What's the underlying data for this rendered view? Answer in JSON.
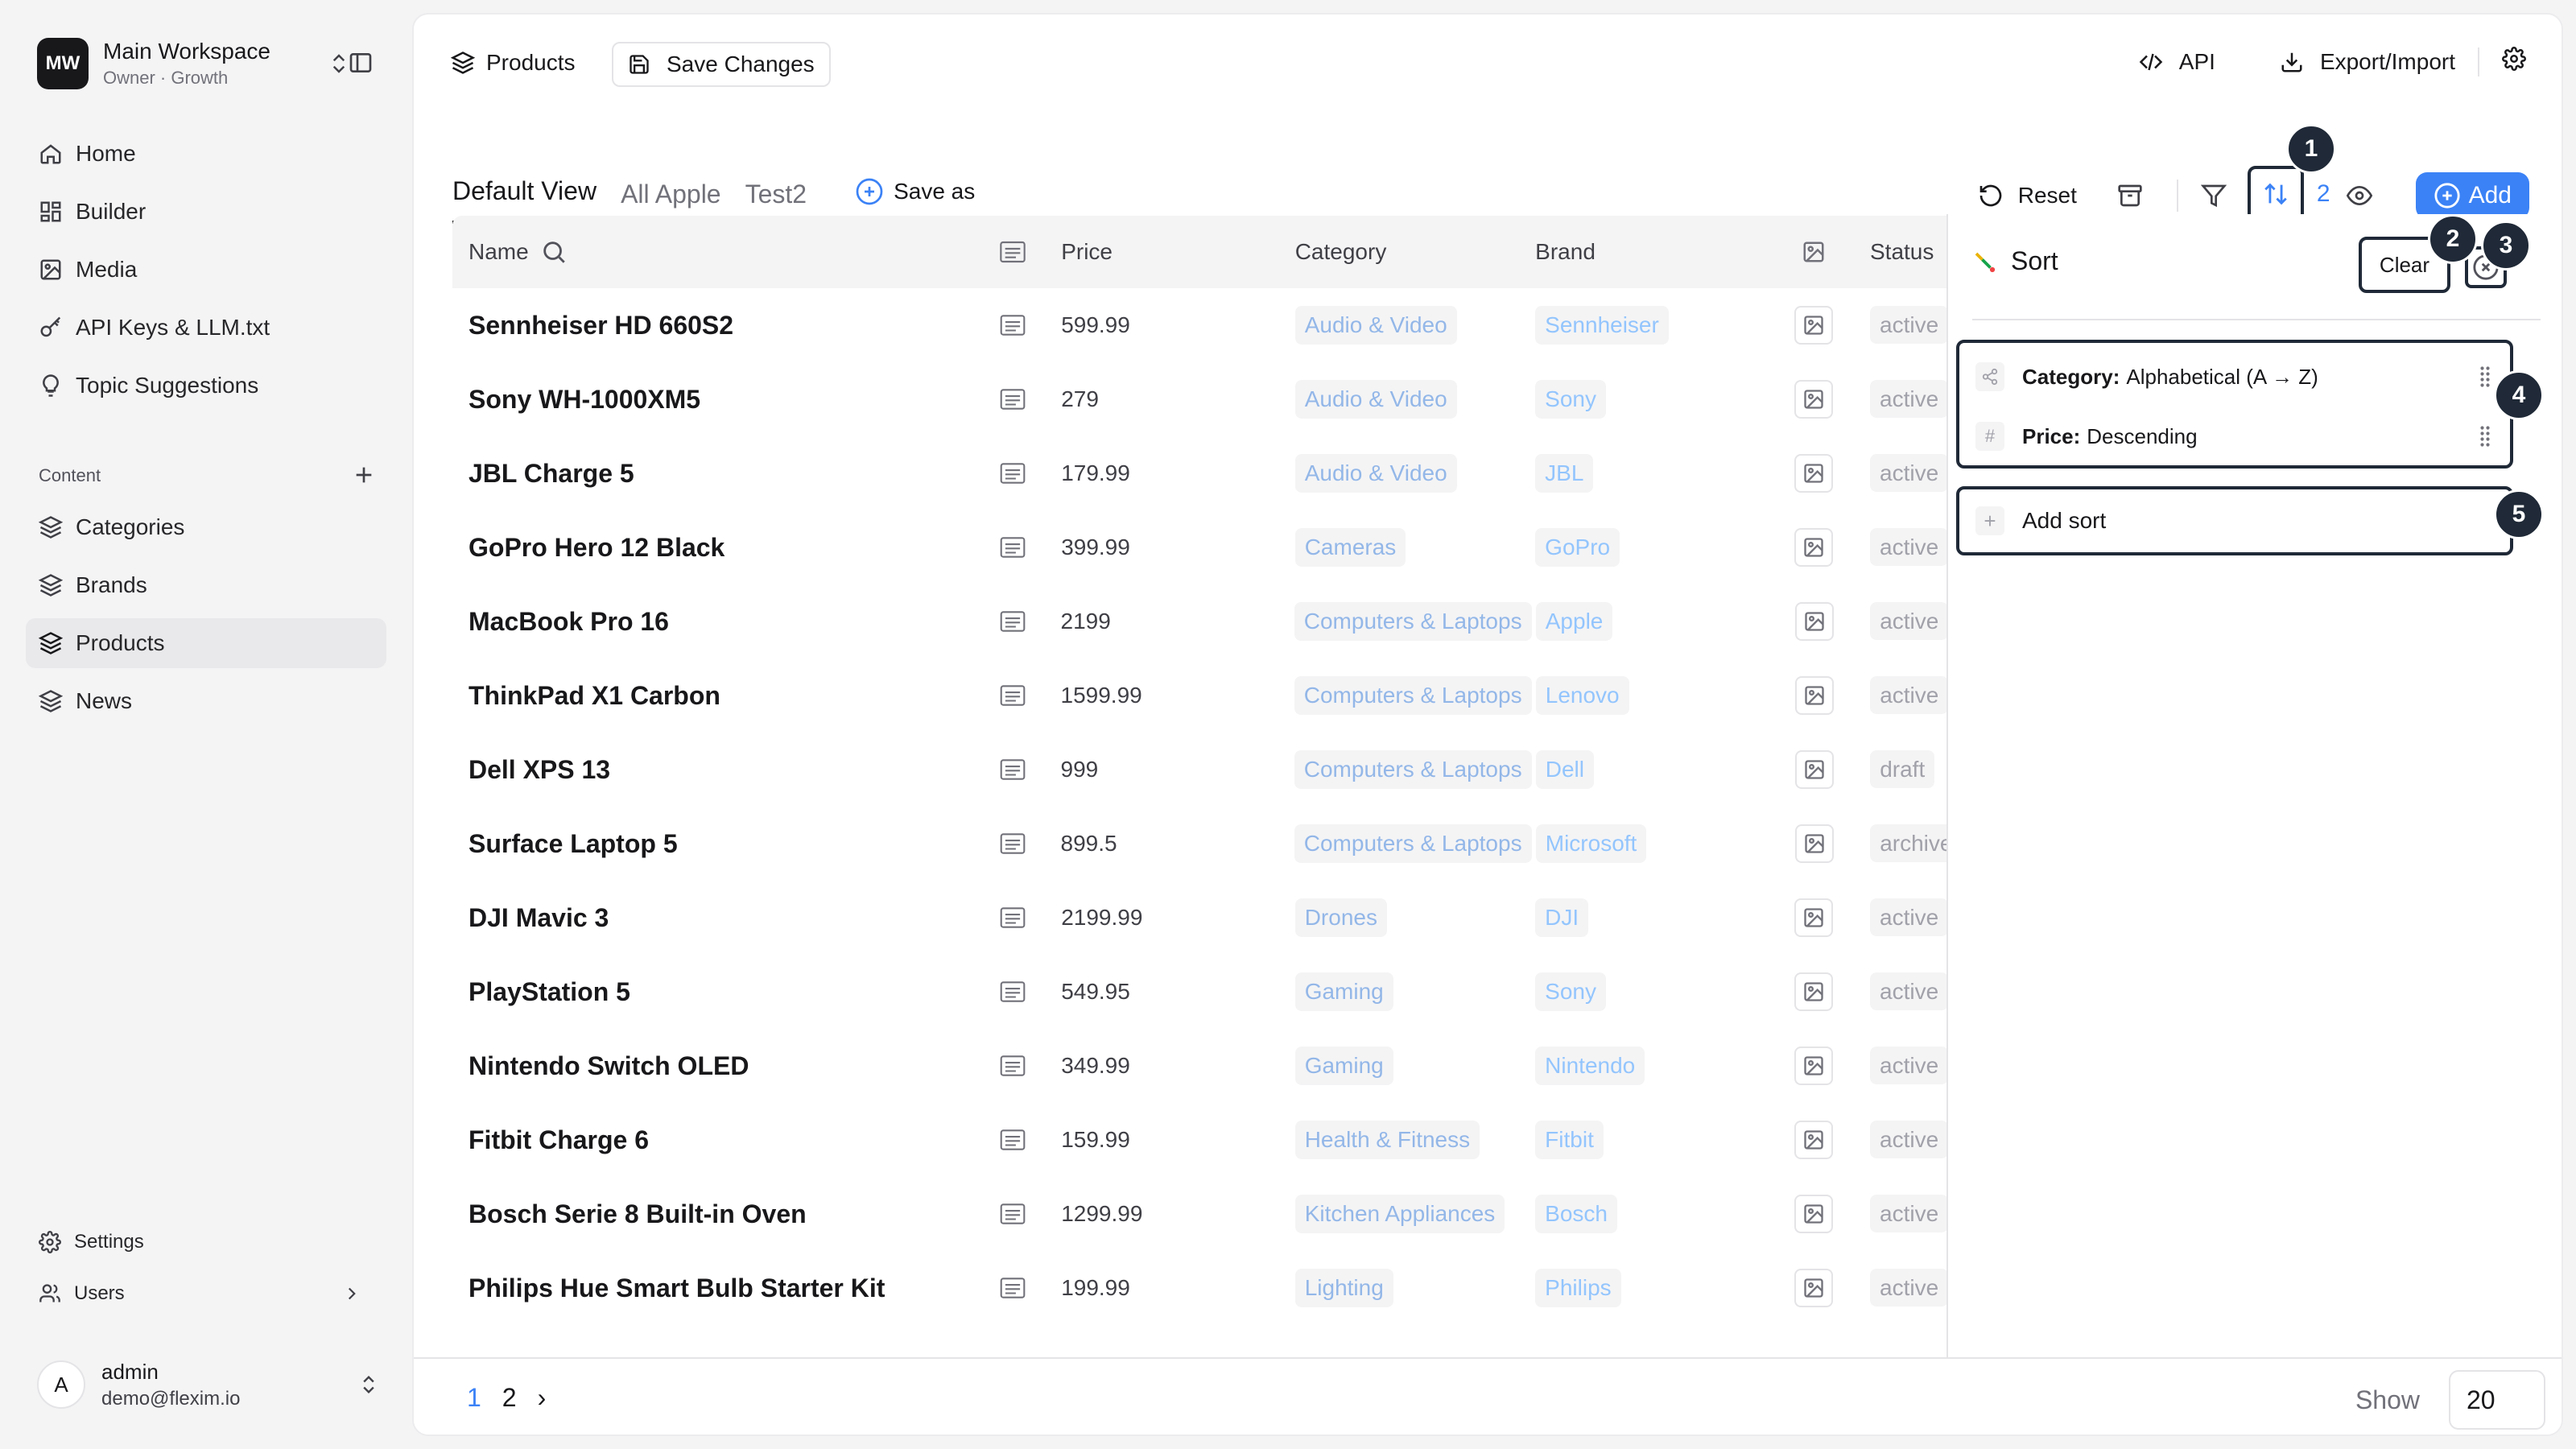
{
  "workspace": {
    "initials": "MW",
    "name": "Main Workspace",
    "subtitle": "Owner · Growth"
  },
  "sidebar": {
    "items": [
      {
        "label": "Home",
        "icon": "home-icon"
      },
      {
        "label": "Builder",
        "icon": "grid-icon"
      },
      {
        "label": "Media",
        "icon": "image-icon"
      },
      {
        "label": "API Keys & LLM.txt",
        "icon": "key-icon"
      },
      {
        "label": "Topic Suggestions",
        "icon": "lightbulb-icon"
      }
    ],
    "content_label": "Content",
    "content_items": [
      {
        "label": "Categories",
        "icon": "layers-icon"
      },
      {
        "label": "Brands",
        "icon": "layers-icon"
      },
      {
        "label": "Products",
        "icon": "layers-icon",
        "active": true
      },
      {
        "label": "News",
        "icon": "layers-icon"
      }
    ],
    "bottom_items": [
      {
        "label": "Settings",
        "icon": "gear-icon"
      },
      {
        "label": "Users",
        "icon": "users-icon"
      }
    ]
  },
  "user": {
    "initial": "A",
    "name": "admin",
    "email": "demo@flexim.io"
  },
  "header": {
    "title": "Products",
    "save_label": "Save Changes",
    "api_label": "API",
    "export_label": "Export/Import"
  },
  "views": {
    "tabs": [
      "Default View",
      "All Apple",
      "Test2"
    ],
    "save_as": "Save as"
  },
  "toolbar": {
    "reset": "Reset",
    "sort_count": "2",
    "add": "Add"
  },
  "table": {
    "headers": {
      "name": "Name",
      "price": "Price",
      "category": "Category",
      "brand": "Brand",
      "status": "Status"
    },
    "rows": [
      {
        "name": "Sennheiser HD 660S2",
        "price": "599.99",
        "category": "Audio & Video",
        "brand": "Sennheiser",
        "status": "active"
      },
      {
        "name": "Sony WH-1000XM5",
        "price": "279",
        "category": "Audio & Video",
        "brand": "Sony",
        "status": "active"
      },
      {
        "name": "JBL Charge 5",
        "price": "179.99",
        "category": "Audio & Video",
        "brand": "JBL",
        "status": "active"
      },
      {
        "name": "GoPro Hero 12 Black",
        "price": "399.99",
        "category": "Cameras",
        "brand": "GoPro",
        "status": "active"
      },
      {
        "name": "MacBook Pro 16",
        "price": "2199",
        "category": "Computers & Laptops",
        "brand": "Apple",
        "status": "active"
      },
      {
        "name": "ThinkPad X1 Carbon",
        "price": "1599.99",
        "category": "Computers & Laptops",
        "brand": "Lenovo",
        "status": "active"
      },
      {
        "name": "Dell XPS 13",
        "price": "999",
        "category": "Computers & Laptops",
        "brand": "Dell",
        "status": "draft"
      },
      {
        "name": "Surface Laptop 5",
        "price": "899.5",
        "category": "Computers & Laptops",
        "brand": "Microsoft",
        "status": "archived"
      },
      {
        "name": "DJI Mavic 3",
        "price": "2199.99",
        "category": "Drones",
        "brand": "DJI",
        "status": "active"
      },
      {
        "name": "PlayStation 5",
        "price": "549.95",
        "category": "Gaming",
        "brand": "Sony",
        "status": "active"
      },
      {
        "name": "Nintendo Switch OLED",
        "price": "349.99",
        "category": "Gaming",
        "brand": "Nintendo",
        "status": "active"
      },
      {
        "name": "Fitbit Charge 6",
        "price": "159.99",
        "category": "Health & Fitness",
        "brand": "Fitbit",
        "status": "active"
      },
      {
        "name": "Bosch Serie 8 Built-in Oven",
        "price": "1299.99",
        "category": "Kitchen Appliances",
        "brand": "Bosch",
        "status": "active"
      },
      {
        "name": "Philips Hue Smart Bulb Starter Kit",
        "price": "199.99",
        "category": "Lighting",
        "brand": "Philips",
        "status": "active"
      }
    ]
  },
  "sort_panel": {
    "title": "Sort",
    "clear": "Clear",
    "rules": [
      {
        "field": "Category:",
        "direction": "Alphabetical (A → Z)",
        "icon": "share-icon"
      },
      {
        "field": "Price:",
        "direction": "Descending",
        "icon": "hash-icon"
      }
    ],
    "add_sort": "Add sort"
  },
  "markers": [
    "1",
    "2",
    "3",
    "4",
    "5"
  ],
  "footer": {
    "pages": [
      "1",
      "2"
    ],
    "next": "›",
    "show_label": "Show",
    "show_value": "20"
  },
  "colors": {
    "accent": "#3b82f6",
    "marker": "#1f2937"
  }
}
